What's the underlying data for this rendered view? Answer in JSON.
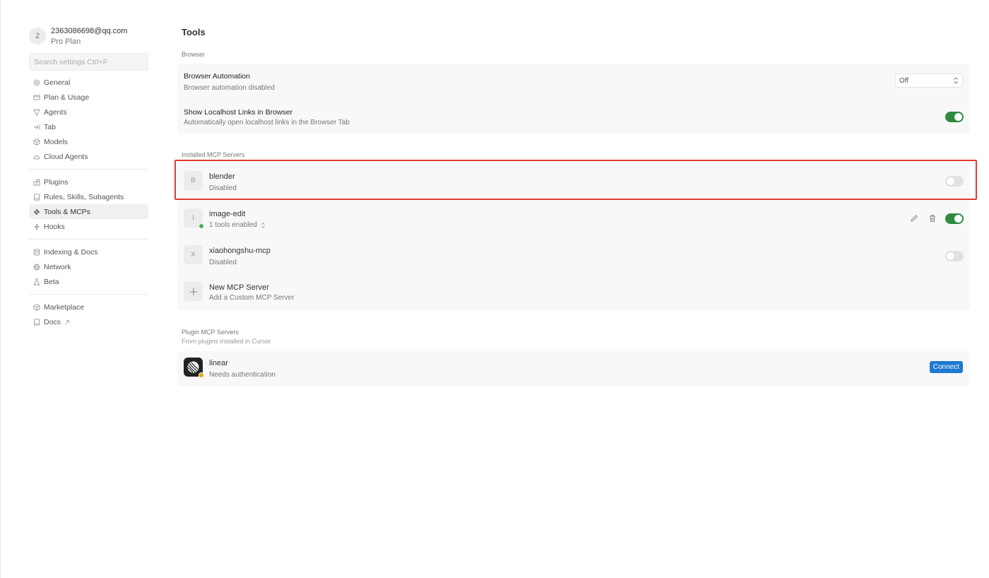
{
  "account": {
    "avatar_letter": "2",
    "email": "2363086698@qq.com",
    "plan": "Pro Plan"
  },
  "search": {
    "placeholder": "Search settings Ctrl+F"
  },
  "sidebar": {
    "group1": [
      {
        "label": "General",
        "icon": "gear-icon"
      },
      {
        "label": "Plan & Usage",
        "icon": "billing-icon"
      },
      {
        "label": "Agents",
        "icon": "agents-icon"
      },
      {
        "label": "Tab",
        "icon": "tab-arrow-icon"
      },
      {
        "label": "Models",
        "icon": "cube-icon"
      },
      {
        "label": "Cloud Agents",
        "icon": "cloud-icon"
      }
    ],
    "group2": [
      {
        "label": "Plugins",
        "icon": "plugin-icon"
      },
      {
        "label": "Rules, Skills, Subagents",
        "icon": "book-icon"
      },
      {
        "label": "Tools & MCPs",
        "icon": "tools-icon",
        "active": true
      },
      {
        "label": "Hooks",
        "icon": "hooks-icon"
      }
    ],
    "group3": [
      {
        "label": "Indexing & Docs",
        "icon": "database-icon"
      },
      {
        "label": "Network",
        "icon": "globe-icon"
      },
      {
        "label": "Beta",
        "icon": "flask-icon"
      }
    ],
    "group4": [
      {
        "label": "Marketplace",
        "icon": "marketplace-icon"
      },
      {
        "label": "Docs",
        "icon": "docs-icon",
        "external": true
      }
    ]
  },
  "main": {
    "title": "Tools",
    "browser_section": {
      "label": "Browser",
      "automation": {
        "title": "Browser Automation",
        "desc": "Browser automation disabled",
        "select_value": "Off"
      },
      "localhost": {
        "title": "Show Localhost Links in Browser",
        "desc": "Automatically open localhost links in the Browser Tab",
        "enabled": true
      }
    },
    "installed_section": {
      "label": "Installed MCP Servers",
      "servers": [
        {
          "letter": "B",
          "name": "blender",
          "status": "Disabled",
          "enabled": false
        },
        {
          "letter": "I",
          "name": "image-edit",
          "status": "1 tools enabled",
          "enabled": true,
          "status_color": "#4caf50"
        },
        {
          "letter": "X",
          "name": "xiaohongshu-mcp",
          "status": "Disabled",
          "enabled": false
        }
      ],
      "new_server": {
        "title": "New MCP Server",
        "desc": "Add a Custom MCP Server"
      }
    },
    "plugin_section": {
      "label": "Plugin MCP Servers",
      "sub": "From plugins installed in Cursor",
      "servers": [
        {
          "name": "linear",
          "status": "Needs authentication",
          "button": "Connect",
          "status_color": "#e0a800"
        }
      ]
    }
  },
  "colors": {
    "accent_green": "#2e8a3e",
    "accent_blue": "#1f78d1",
    "highlight_red": "#e03a2f"
  }
}
